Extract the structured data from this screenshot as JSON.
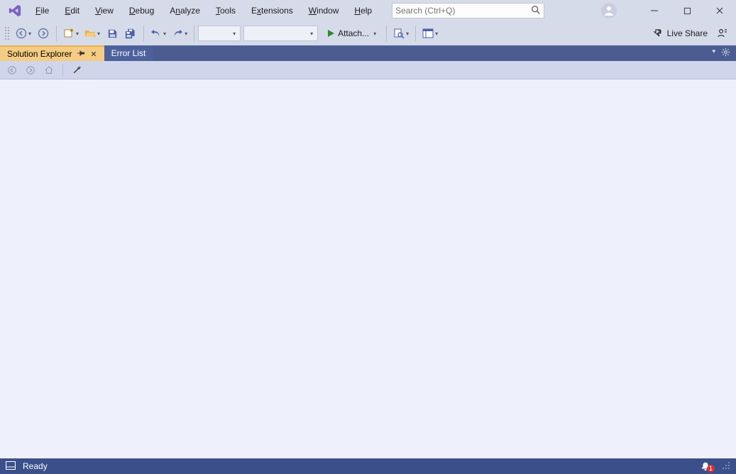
{
  "menu": {
    "file": "File",
    "edit": "Edit",
    "view": "View",
    "debug": "Debug",
    "analyze": "Analyze",
    "tools": "Tools",
    "extensions": "Extensions",
    "window": "Window",
    "help": "Help"
  },
  "search": {
    "placeholder": "Search (Ctrl+Q)"
  },
  "toolbar": {
    "attach_label": "Attach...",
    "live_share_label": "Live Share"
  },
  "tabs": {
    "solution_explorer": "Solution Explorer",
    "error_list": "Error List"
  },
  "status": {
    "ready": "Ready",
    "notification_count": "1"
  }
}
